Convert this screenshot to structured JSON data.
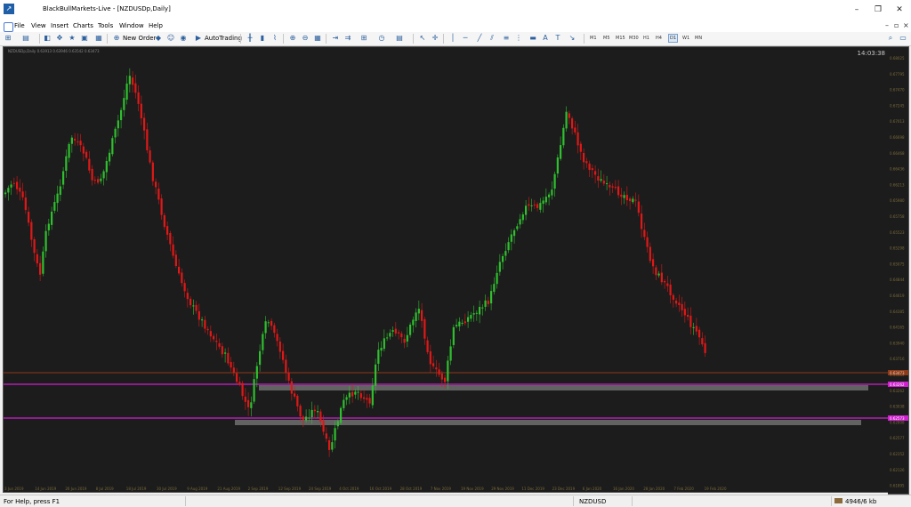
{
  "window": {
    "title": "BlackBullMarkets-Live - [NZDUSDp,Daily]",
    "controls": [
      "–",
      "❐",
      "✕"
    ]
  },
  "menu": {
    "items": [
      "File",
      "View",
      "Insert",
      "Charts",
      "Tools",
      "Window",
      "Help"
    ],
    "mdi_controls": [
      "–",
      "▫",
      "×"
    ]
  },
  "toolbar": {
    "new_order": "New Order",
    "autotrading": "AutoTrading",
    "timeframes": [
      "M1",
      "M5",
      "M15",
      "M30",
      "H1",
      "H4",
      "D1",
      "W1",
      "MN"
    ],
    "active_timeframe": "D1"
  },
  "chart": {
    "symbol_info": "NZDUSDp,Daily  0.63913 0.63946 0.63542 0.63473",
    "clock": "14:03:38",
    "colors": {
      "background": "#1c1c1c",
      "bull": "#2fbf2f",
      "bear": "#e01818",
      "level_line": "#d020d0",
      "zone": "#7a7a7a",
      "current_price_line": "#8b3a1a",
      "axis_text": "#7a6a3a"
    },
    "price_labels": [
      "0.68025",
      "0.67795",
      "0.67470",
      "0.67245",
      "0.67013",
      "0.66698",
      "0.66468",
      "0.66436",
      "0.66213",
      "0.65980",
      "0.65758",
      "0.65523",
      "0.65298",
      "0.65075",
      "0.64844",
      "0.64619",
      "0.64385",
      "0.64165",
      "0.63940",
      "0.63716",
      "0.63484",
      "0.63262",
      "0.63038",
      "0.62808",
      "0.62577",
      "0.62352",
      "0.62126",
      "0.61895"
    ],
    "current_price_badge": "0.63473",
    "level_labels": [
      "0.63262",
      "0.62573"
    ],
    "date_labels": [
      "3 Jun 2019",
      "14 Jun 2019",
      "26 Jun 2019",
      "8 Jul 2019",
      "18 Jul 2019",
      "30 Jul 2019",
      "9 Aug 2019",
      "21 Aug 2019",
      "2 Sep 2019",
      "12 Sep 2019",
      "24 Sep 2019",
      "4 Oct 2019",
      "16 Oct 2019",
      "28 Oct 2019",
      "7 Nov 2019",
      "19 Nov 2019",
      "29 Nov 2019",
      "11 Dec 2019",
      "23 Dec 2019",
      "6 Jan 2020",
      "16 Jan 2020",
      "28 Jan 2020",
      "7 Feb 2020",
      "19 Feb 2020"
    ]
  },
  "status": {
    "help": "For Help, press F1",
    "symbol": "NZDUSD",
    "connection": "4946/6 kb"
  }
}
